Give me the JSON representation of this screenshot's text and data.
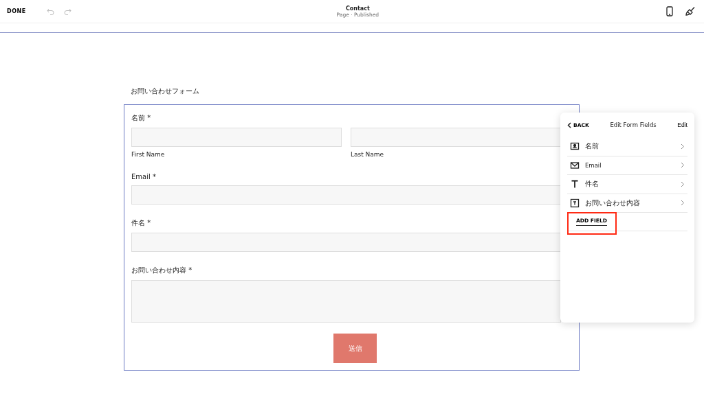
{
  "toolbar": {
    "done": "DONE",
    "title": "Contact",
    "subtitle": "Page · Published"
  },
  "form": {
    "heading": "お問い合わせフォーム",
    "name_label": "名前 *",
    "first_name": "First Name",
    "last_name": "Last Name",
    "fields": [
      {
        "label": "Email *",
        "kind": "input"
      },
      {
        "label": "件名 *",
        "kind": "input"
      },
      {
        "label": "お問い合わせ内容 *",
        "kind": "textarea"
      }
    ],
    "submit": "送信"
  },
  "panel": {
    "back": "BACK",
    "title": "Edit Form Fields",
    "edit": "Edit",
    "items": [
      {
        "label": "名前",
        "kind": "name"
      },
      {
        "label": "Email",
        "kind": "email"
      },
      {
        "label": "件名",
        "kind": "text"
      },
      {
        "label": "お問い合わせ内容",
        "kind": "textarea"
      }
    ],
    "add_field": {
      "label": "ADD FIELD",
      "highlighted": true
    }
  }
}
